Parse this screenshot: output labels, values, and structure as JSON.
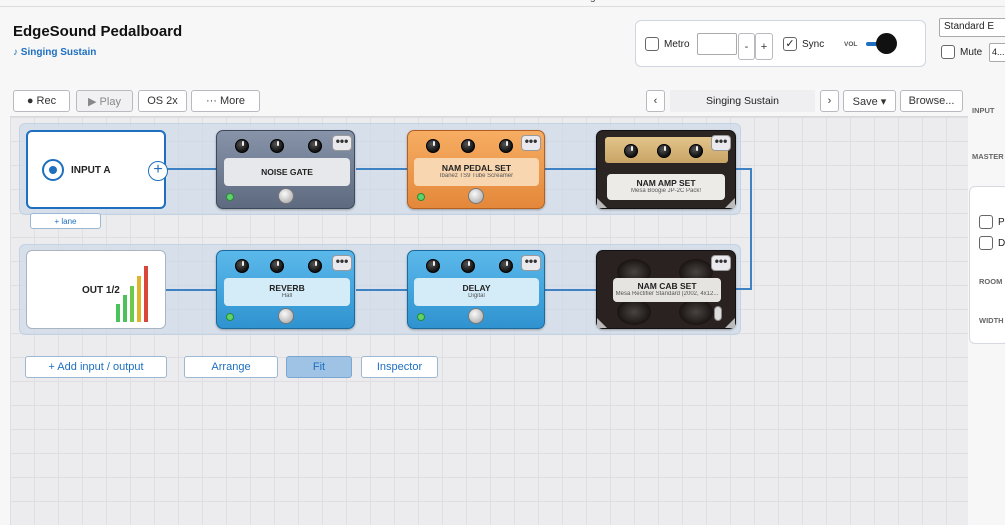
{
  "window_title_fragment": "g",
  "app": {
    "title": "EdgeSound Pedalboard",
    "preset_name": "♪ Singing Sustain"
  },
  "transport": {
    "metro_label": "Metro",
    "minus": "-",
    "plus": "+",
    "sync_label": "Sync",
    "vol_label": "VOL",
    "tuning": "Standard E",
    "mute_label": "Mute",
    "mute_value": "4..."
  },
  "toolbar": {
    "rec": "● Rec",
    "play": "▶ Play",
    "os": "OS 2x",
    "more": "··· More",
    "prev": "‹",
    "preset": "Singing Sustain",
    "next": "›",
    "save": "Save ▾",
    "browse": "Browse..."
  },
  "side_panel": {
    "input": "INPUT",
    "master": "MASTER",
    "room": "ROOM",
    "width": "WIDTH",
    "opt1": "Pl",
    "opt2": "D"
  },
  "board": {
    "input": {
      "label": "INPUT A",
      "add_lane": "+ lane"
    },
    "output": {
      "label": "OUT 1/2"
    },
    "pedals": [
      {
        "name": "NOISE GATE",
        "sub": ""
      },
      {
        "name": "NAM PEDAL SET",
        "sub": "Ibanez TS9 Tube Screamer"
      },
      {
        "name": "NAM AMP SET",
        "sub": "Mesa Boogie JP-2C Pack!"
      },
      {
        "name": "REVERB",
        "sub": "Hall"
      },
      {
        "name": "DELAY",
        "sub": "Digital"
      },
      {
        "name": "NAM CAB SET",
        "sub": "Mesa Rectifier Standard (2002, 4x12..."
      }
    ],
    "more_glyph": "•••"
  },
  "bottom": {
    "add_io": "+  Add input / output",
    "arrange": "Arrange",
    "fit": "Fit",
    "inspector": "Inspector"
  },
  "colors": {
    "accent": "#1e6fbf",
    "gate": "#6e7d95",
    "pedal": "#f19a45",
    "amp": "#2a2422",
    "blue_pedal": "#3fa7e0",
    "cab": "#2a2220"
  }
}
